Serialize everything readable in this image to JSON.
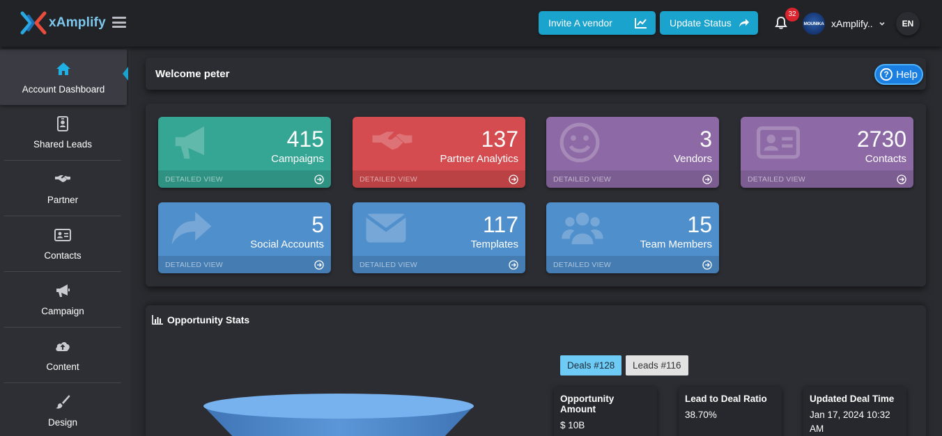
{
  "header": {
    "logo_text": "xAmplify",
    "invite_button": "Invite A vendor",
    "update_button": "Update Status",
    "notification_count": "32",
    "avatar_text": "MOUNIKA",
    "user_name": "xAmplify..",
    "language": "EN"
  },
  "sidebar": {
    "items": [
      {
        "label": "Account Dashboard",
        "icon": "home-icon",
        "active": true
      },
      {
        "label": "Shared Leads",
        "icon": "id-badge-icon"
      },
      {
        "label": "Partner",
        "icon": "handshake-icon"
      },
      {
        "label": "Contacts",
        "icon": "address-card-icon"
      },
      {
        "label": "Campaign",
        "icon": "megaphone-icon"
      },
      {
        "label": "Content",
        "icon": "cloud-upload-icon"
      },
      {
        "label": "Design",
        "icon": "paintbrush-icon"
      }
    ]
  },
  "welcome": {
    "title": "Welcome peter",
    "help_label": "Help"
  },
  "cards": {
    "detail_label": "DETAILED VIEW",
    "items": [
      {
        "count": "415",
        "title": "Campaigns",
        "color": "#35a594",
        "icon": "megaphone-icon"
      },
      {
        "count": "137",
        "title": "Partner Analytics",
        "color": "#d44c4f",
        "icon": "handshake-icon"
      },
      {
        "count": "3",
        "title": "Vendors",
        "color": "#8d6aa6",
        "icon": "smile-icon"
      },
      {
        "count": "2730",
        "title": "Contacts",
        "color": "#8d6aa6",
        "icon": "address-card-icon"
      },
      {
        "count": "5",
        "title": "Social Accounts",
        "color": "#4f8fcc",
        "icon": "share-icon"
      },
      {
        "count": "117",
        "title": "Templates",
        "color": "#4f8fcc",
        "icon": "envelope-icon"
      },
      {
        "count": "15",
        "title": "Team Members",
        "color": "#4f8fcc",
        "icon": "users-icon"
      }
    ]
  },
  "opportunity": {
    "title": "Opportunity Stats",
    "tab_deals": "Deals #128",
    "tab_leads": "Leads #116",
    "metrics": [
      {
        "label": "Opportunity Amount",
        "value": "$ 10B"
      },
      {
        "label": "Lead to Deal Ratio",
        "value": "38.70%"
      },
      {
        "label": "Updated Deal Time",
        "value": "Jan 17, 2024 10:32 AM"
      }
    ]
  }
}
